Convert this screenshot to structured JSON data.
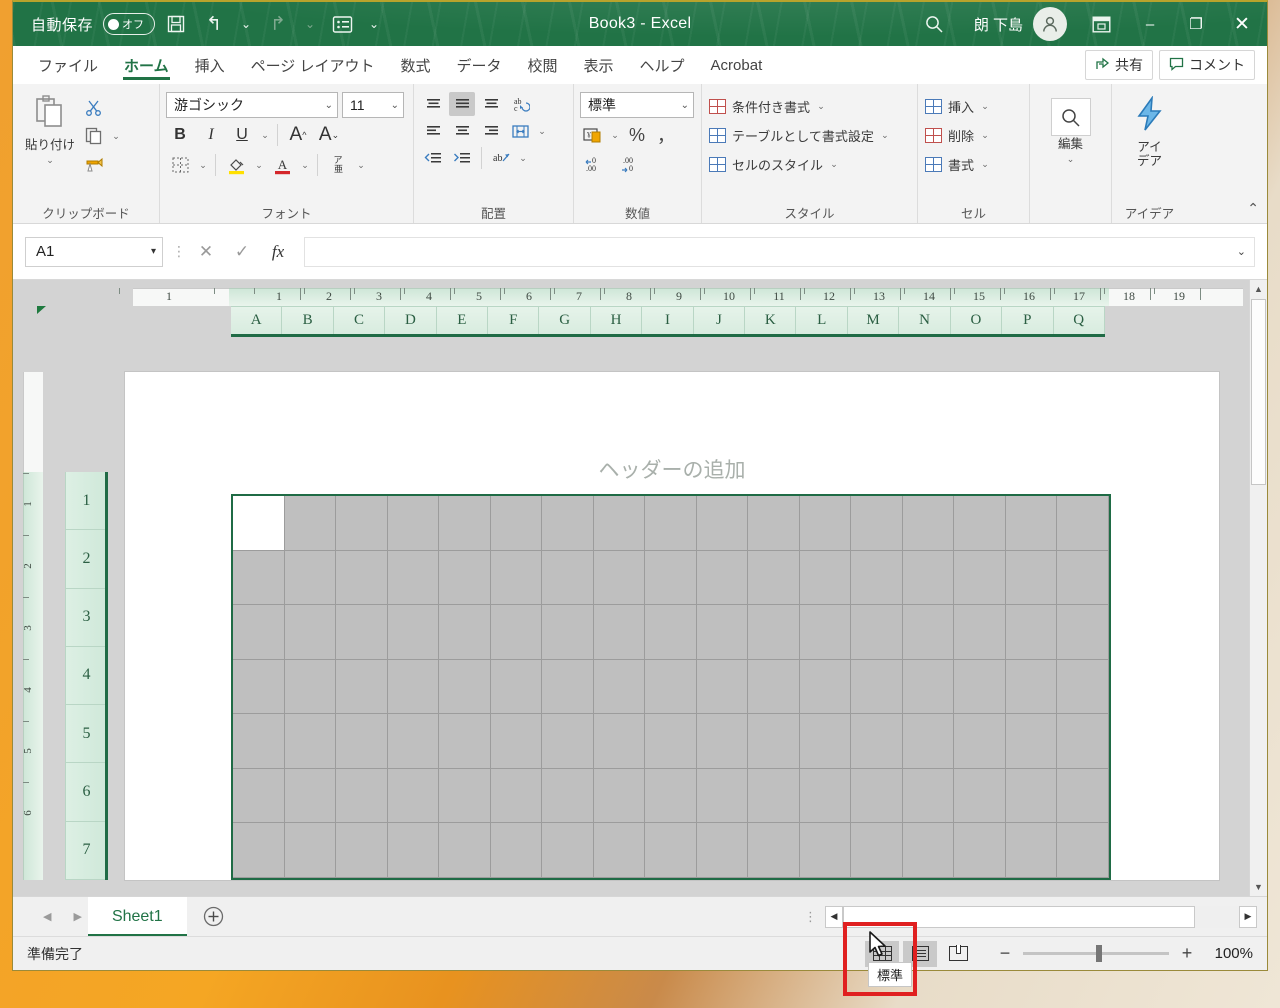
{
  "titlebar": {
    "autosave_label": "自動保存",
    "autosave_state": "オフ",
    "save_icon": "save-icon",
    "undo_icon": "undo-icon",
    "redo_icon": "redo-icon",
    "touch_icon": "touch-mode-icon",
    "more_icon": "chevron-down-icon",
    "title": "Book3 - Excel",
    "search_icon": "search-icon",
    "account_name": "朗 下島",
    "avatar_icon": "person-icon",
    "ribbon_display_icon": "ribbon-display-options-icon",
    "minimize": "–",
    "maximize": "❐",
    "close": "✕"
  },
  "tabs": [
    {
      "label": "ファイル",
      "active": false
    },
    {
      "label": "ホーム",
      "active": true
    },
    {
      "label": "挿入",
      "active": false
    },
    {
      "label": "ページ レイアウト",
      "active": false
    },
    {
      "label": "数式",
      "active": false
    },
    {
      "label": "データ",
      "active": false
    },
    {
      "label": "校閲",
      "active": false
    },
    {
      "label": "表示",
      "active": false
    },
    {
      "label": "ヘルプ",
      "active": false
    },
    {
      "label": "Acrobat",
      "active": false
    }
  ],
  "tabbar_right": {
    "share_label": "共有",
    "share_icon": "share-icon",
    "comments_label": "コメント",
    "comments_icon": "comment-icon"
  },
  "ribbon": {
    "clipboard": {
      "name": "クリップボード",
      "paste_label": "貼り付け",
      "cut_icon": "scissors-icon",
      "copy_icon": "copy-icon",
      "format_painter_icon": "format-painter-icon",
      "dialog_launcher": "⇲"
    },
    "font": {
      "name": "フォント",
      "font_family_value": "游ゴシック",
      "font_size_value": "11",
      "bold": "B",
      "italic": "I",
      "underline": "U",
      "grow_font": "A",
      "shrink_font": "A",
      "borders_icon": "borders-icon",
      "fill_color_icon": "fill-color-icon",
      "font_color_icon": "font-color-icon",
      "phonetic_icon": "phonetic-guide-icon",
      "dialog_launcher": "⇲"
    },
    "alignment": {
      "name": "配置",
      "align_top_icon": "align-top-icon",
      "align_middle_icon": "align-middle-icon",
      "align_bottom_icon": "align-bottom-icon",
      "orientation_icon": "orientation-icon",
      "align_left_icon": "align-left-icon",
      "align_center_icon": "align-center-icon",
      "align_right_icon": "align-right-icon",
      "wrap_text_icon": "wrap-text-icon",
      "decrease_indent_icon": "decrease-indent-icon",
      "increase_indent_icon": "increase-indent-icon",
      "merge_icon": "merge-cells-icon",
      "dialog_launcher": "⇲"
    },
    "number": {
      "name": "数値",
      "format_value": "標準",
      "accounting_icon": "accounting-format-icon",
      "percent_icon": "%",
      "comma_icon": "，",
      "increase_decimal_icon": "increase-decimal-icon",
      "decrease_decimal_icon": "decrease-decimal-icon",
      "dialog_launcher": "⇲"
    },
    "styles": {
      "name": "スタイル",
      "items": [
        {
          "label": "条件付き書式",
          "icon": "conditional-formatting-icon"
        },
        {
          "label": "テーブルとして書式設定",
          "icon": "format-as-table-icon"
        },
        {
          "label": "セルのスタイル",
          "icon": "cell-styles-icon"
        }
      ]
    },
    "cells": {
      "name": "セル",
      "items": [
        {
          "label": "挿入",
          "icon": "insert-cells-icon"
        },
        {
          "label": "削除",
          "icon": "delete-cells-icon"
        },
        {
          "label": "書式",
          "icon": "format-cells-icon"
        }
      ]
    },
    "editing": {
      "name": "",
      "label": "編集",
      "icon": "find-select-icon"
    },
    "ideas": {
      "name": "アイデア",
      "label": "アイ\nデア",
      "icon": "ideas-lightning-icon"
    },
    "collapse_icon": "collapse-ribbon-icon"
  },
  "formula_bar": {
    "name_box_value": "A1",
    "name_box_caret": "▾",
    "cancel_icon": "✕",
    "enter_icon": "✓",
    "function_icon": "fx",
    "formula_value": "",
    "expand_icon": "⌄"
  },
  "worksheet": {
    "page_header_placeholder": "ヘッダーの追加",
    "column_headers": [
      "A",
      "B",
      "C",
      "D",
      "E",
      "F",
      "G",
      "H",
      "I",
      "J",
      "K",
      "L",
      "M",
      "N",
      "O",
      "P",
      "Q"
    ],
    "row_headers": [
      "1",
      "2",
      "3",
      "4",
      "5",
      "6",
      "7"
    ],
    "h_ruler_margin_numbers": [
      "1"
    ],
    "h_ruler_numbers": [
      "1",
      "2",
      "3",
      "4",
      "5",
      "6",
      "7",
      "8",
      "9",
      "10",
      "11",
      "12",
      "13",
      "14",
      "15",
      "16",
      "17",
      "18",
      "19"
    ],
    "v_ruler_numbers": [
      "1",
      "2",
      "3",
      "4",
      "5",
      "6"
    ],
    "active_cell": "A1",
    "select_all_icon": "select-all-triangle-icon"
  },
  "sheet_tabs": {
    "prev_icon": "◀",
    "next_icon": "▶",
    "tabs": [
      {
        "label": "Sheet1",
        "active": true
      }
    ],
    "add_sheet_icon": "+",
    "hscroll_left_icon": "◀",
    "hscroll_right_icon": "▶"
  },
  "status_bar": {
    "status_text": "準備完了",
    "views": [
      {
        "name": "normal-view",
        "label": "標準",
        "selected": true
      },
      {
        "name": "page-layout-view",
        "label": "ページ レイアウト",
        "selected": false
      },
      {
        "name": "page-break-preview",
        "label": "改ページ プレビュー",
        "selected": false
      }
    ],
    "zoom_out_icon": "−",
    "zoom_in_icon": "+",
    "zoom_level": "100%"
  },
  "annotation": {
    "tooltip_text": "標準",
    "highlight_color": "#e02020",
    "cursor_icon": "mouse-pointer-icon"
  },
  "colors": {
    "brand_green": "#217346",
    "ribbon_bg": "#f3f3f3",
    "header_green": "#cfe8d9",
    "grid_gray": "#bfbfbf"
  }
}
